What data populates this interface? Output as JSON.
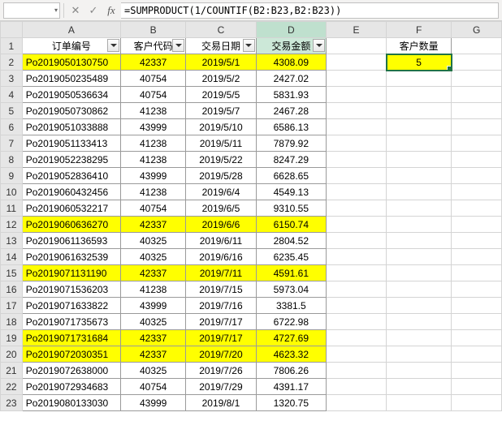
{
  "formula_bar": {
    "namebox_value": "",
    "formula": "=SUMPRODUCT(1/COUNTIF(B2:B23,B2:B23))",
    "fx_label": "fx",
    "cancel_glyph": "✕",
    "confirm_glyph": "✓",
    "dropdown_glyph": "▾"
  },
  "columns": [
    "A",
    "B",
    "C",
    "D",
    "E",
    "F",
    "G"
  ],
  "row_numbers": [
    "1",
    "2",
    "3",
    "4",
    "5",
    "6",
    "7",
    "8",
    "9",
    "10",
    "11",
    "12",
    "13",
    "14",
    "15",
    "16",
    "17",
    "18",
    "19",
    "20",
    "21",
    "22",
    "23"
  ],
  "headers": {
    "order_no": "订单编号",
    "cust_code": "客户代码",
    "trade_date": "交易日期",
    "trade_amt": "交易金额"
  },
  "summary": {
    "label": "客户数量",
    "value": "5"
  },
  "rows": [
    {
      "a": "Po2019050130750",
      "b": "42337",
      "c": "2019/5/1",
      "d": "4308.09",
      "hl": true
    },
    {
      "a": "Po2019050235489",
      "b": "40754",
      "c": "2019/5/2",
      "d": "2427.02",
      "hl": false
    },
    {
      "a": "Po2019050536634",
      "b": "40754",
      "c": "2019/5/5",
      "d": "5831.93",
      "hl": false
    },
    {
      "a": "Po2019050730862",
      "b": "41238",
      "c": "2019/5/7",
      "d": "2467.28",
      "hl": false
    },
    {
      "a": "Po2019051033888",
      "b": "43999",
      "c": "2019/5/10",
      "d": "6586.13",
      "hl": false
    },
    {
      "a": "Po2019051133413",
      "b": "41238",
      "c": "2019/5/11",
      "d": "7879.92",
      "hl": false
    },
    {
      "a": "Po2019052238295",
      "b": "41238",
      "c": "2019/5/22",
      "d": "8247.29",
      "hl": false
    },
    {
      "a": "Po2019052836410",
      "b": "43999",
      "c": "2019/5/28",
      "d": "6628.65",
      "hl": false
    },
    {
      "a": "Po2019060432456",
      "b": "41238",
      "c": "2019/6/4",
      "d": "4549.13",
      "hl": false
    },
    {
      "a": "Po2019060532217",
      "b": "40754",
      "c": "2019/6/5",
      "d": "9310.55",
      "hl": false
    },
    {
      "a": "Po2019060636270",
      "b": "42337",
      "c": "2019/6/6",
      "d": "6150.74",
      "hl": true
    },
    {
      "a": "Po2019061136593",
      "b": "40325",
      "c": "2019/6/11",
      "d": "2804.52",
      "hl": false
    },
    {
      "a": "Po2019061632539",
      "b": "40325",
      "c": "2019/6/16",
      "d": "6235.45",
      "hl": false
    },
    {
      "a": "Po2019071131190",
      "b": "42337",
      "c": "2019/7/11",
      "d": "4591.61",
      "hl": true
    },
    {
      "a": "Po2019071536203",
      "b": "41238",
      "c": "2019/7/15",
      "d": "5973.04",
      "hl": false
    },
    {
      "a": "Po2019071633822",
      "b": "43999",
      "c": "2019/7/16",
      "d": "3381.5",
      "hl": false
    },
    {
      "a": "Po2019071735673",
      "b": "40325",
      "c": "2019/7/17",
      "d": "6722.98",
      "hl": false
    },
    {
      "a": "Po2019071731684",
      "b": "42337",
      "c": "2019/7/17",
      "d": "4727.69",
      "hl": true
    },
    {
      "a": "Po2019072030351",
      "b": "42337",
      "c": "2019/7/20",
      "d": "4623.32",
      "hl": true
    },
    {
      "a": "Po2019072638000",
      "b": "40325",
      "c": "2019/7/26",
      "d": "7806.26",
      "hl": false
    },
    {
      "a": "Po2019072934683",
      "b": "40754",
      "c": "2019/7/29",
      "d": "4391.17",
      "hl": false
    },
    {
      "a": "Po2019080133030",
      "b": "43999",
      "c": "2019/8/1",
      "d": "1320.75",
      "hl": false
    }
  ]
}
